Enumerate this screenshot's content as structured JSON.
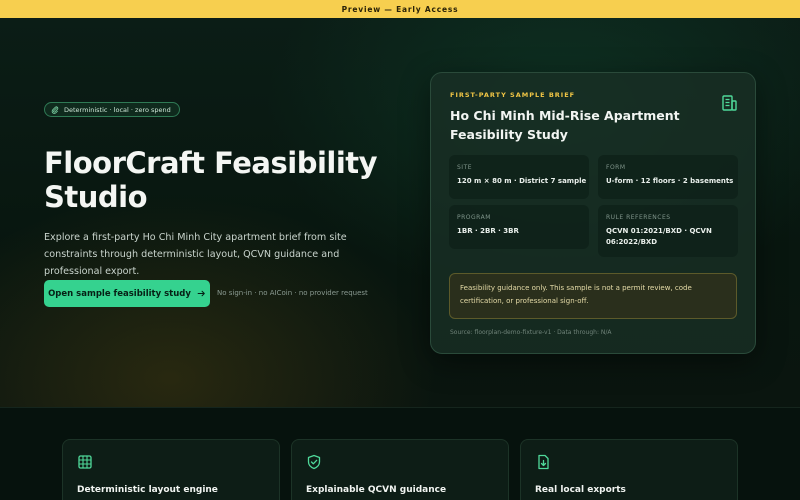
{
  "banner": {
    "text": "Preview — Early Access"
  },
  "hero": {
    "pill": "Deterministic · local · zero spend",
    "title": "FloorCraft Feasibility Studio",
    "description": "Explore a first-party Ho Chi Minh City apartment brief from site constraints through deterministic layout, QCVN guidance and professional export.",
    "cta_label": "Open sample feasibility study",
    "cta_note": "No sign-in · no AICoin · no provider request"
  },
  "card": {
    "eyebrow": "FIRST-PARTY SAMPLE BRIEF",
    "title": "Ho Chi Minh Mid-Rise Apartment Feasibility Study",
    "icon": "building-icon",
    "facts": [
      {
        "label": "SITE",
        "value": "120 m × 80 m · District 7 sample"
      },
      {
        "label": "FORM",
        "value": "U-form · 12 floors · 2 basements"
      },
      {
        "label": "PROGRAM",
        "value": "1BR · 2BR · 3BR"
      },
      {
        "label": "RULE REFERENCES",
        "value": "QCVN 01:2021/BXD · QCVN 06:2022/BXD"
      }
    ],
    "notice": "Feasibility guidance only. This sample is not a permit review, code certification, or professional sign-off.",
    "source": "Source: floorplan-demo-fixture-v1 · Data through: N/A"
  },
  "features": [
    {
      "title": "Deterministic layout engine",
      "icon": "grid-icon"
    },
    {
      "title": "Explainable QCVN guidance",
      "icon": "shield-check-icon"
    },
    {
      "title": "Real local exports",
      "icon": "download-file-icon"
    }
  ],
  "colors": {
    "accent": "#35d28f",
    "banner": "#f7cf4f",
    "eyebrow": "#f0c545"
  }
}
